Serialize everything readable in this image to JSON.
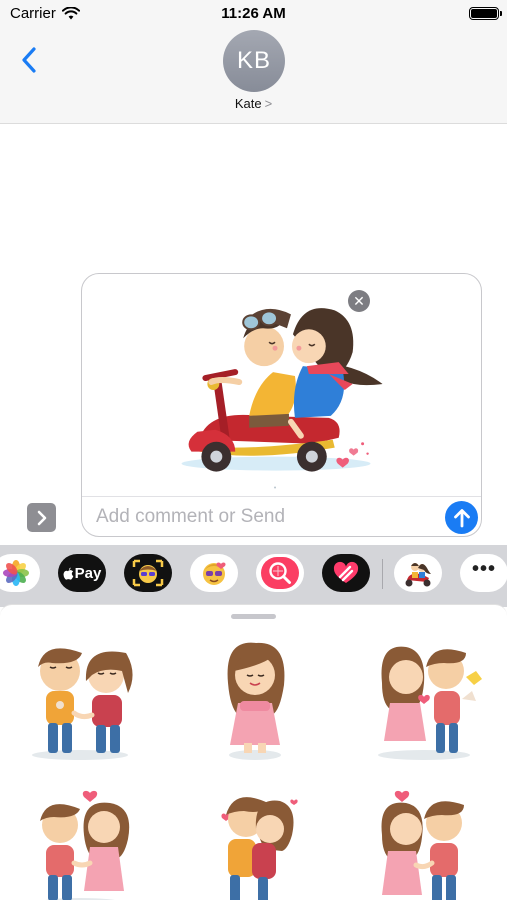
{
  "status_bar": {
    "carrier": "Carrier",
    "time": "11:26 AM"
  },
  "header": {
    "avatar_initials": "KB",
    "contact_name": "Kate",
    "contact_chevron": ">"
  },
  "compose": {
    "placeholder": "Add comment or Send",
    "remove_symbol": "✕"
  },
  "app_strip": {
    "apps": [
      {
        "name": "photos",
        "icon": "photos-icon"
      },
      {
        "name": "apple-pay",
        "label": "Pay",
        "icon": "apple-pay-icon"
      },
      {
        "name": "memoji",
        "icon": "memoji-icon"
      },
      {
        "name": "animoji",
        "icon": "animoji-icon"
      },
      {
        "name": "images-search",
        "icon": "image-search-icon"
      },
      {
        "name": "digital-touch",
        "icon": "digital-touch-icon"
      },
      {
        "name": "love-stickers",
        "icon": "scooter-couple-icon"
      },
      {
        "name": "more",
        "label": "•••",
        "icon": "more-icon"
      }
    ]
  },
  "stickers": [
    "couple-holding-hands",
    "girl-smiling",
    "girl-kissing-boy",
    "couple-with-heart",
    "couple-hugging",
    "girl-kissing-boy-heart"
  ],
  "colors": {
    "accent": "#1a7cf4",
    "nav_bg": "#f6f6f6",
    "strip_bg": "#d4d5d9"
  }
}
